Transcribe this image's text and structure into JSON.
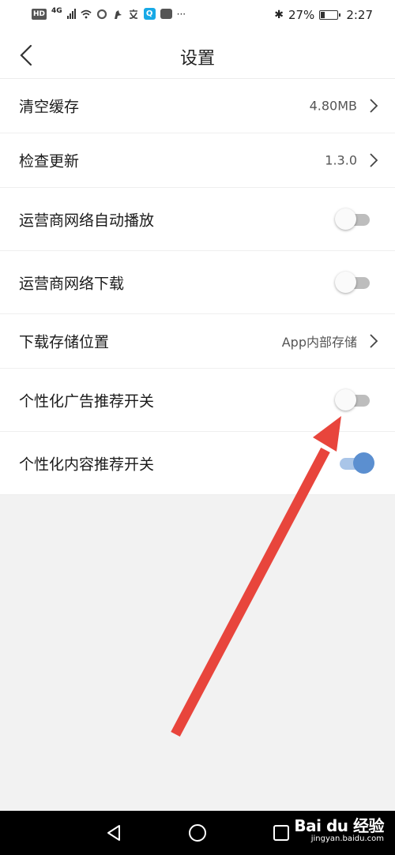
{
  "status_bar": {
    "hd": "HD",
    "net": "4G",
    "bluetooth": "✱",
    "battery_pct": "27%",
    "battery_level": 0.27,
    "time": "2:27",
    "more": "···"
  },
  "header": {
    "title": "设置"
  },
  "settings": [
    {
      "label": "清空缓存",
      "value": "4.80MB",
      "type": "link"
    },
    {
      "label": "检查更新",
      "value": "1.3.0",
      "type": "link"
    },
    {
      "label": "运营商网络自动播放",
      "type": "toggle",
      "on": false
    },
    {
      "label": "运营商网络下载",
      "type": "toggle",
      "on": false
    },
    {
      "label": "下载存储位置",
      "value": "App内部存储",
      "type": "link"
    },
    {
      "label": "个性化广告推荐开关",
      "type": "toggle",
      "on": false
    },
    {
      "label": "个性化内容推荐开关",
      "type": "toggle",
      "on": true
    }
  ],
  "watermark": {
    "main": "Bai du 经验",
    "sub": "jingyan.baidu.com"
  },
  "colors": {
    "annotation_arrow": "#e8453c",
    "toggle_on": "#5b8fd0"
  }
}
